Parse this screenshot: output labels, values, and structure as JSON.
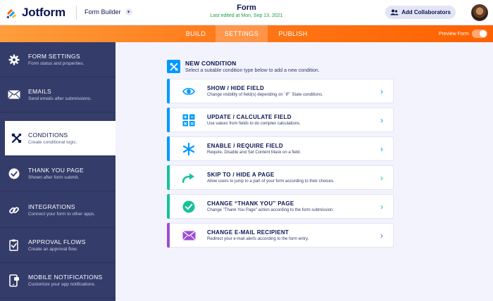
{
  "header": {
    "logo_text": "Jotform",
    "builder_label": "Form Builder",
    "form_title": "Form",
    "last_edited": "Last edited at Mon, Sep 13, 2021",
    "collaborators_label": "Add Collaborators"
  },
  "nav": {
    "tabs": [
      {
        "label": "BUILD"
      },
      {
        "label": "SETTINGS"
      },
      {
        "label": "PUBLISH"
      }
    ],
    "preview_label": "Preview Form",
    "active_tab": "SETTINGS"
  },
  "sidebar": {
    "items": [
      {
        "title": "FORM SETTINGS",
        "desc": "Form status and properties.",
        "icon": "gear-icon"
      },
      {
        "title": "EMAILS",
        "desc": "Send emails after submissions.",
        "icon": "envelope-icon"
      },
      {
        "title": "CONDITIONS",
        "desc": "Create conditional logic.",
        "icon": "conditions-icon"
      },
      {
        "title": "THANK YOU PAGE",
        "desc": "Shown after form submit.",
        "icon": "check-circle-icon"
      },
      {
        "title": "INTEGRATIONS",
        "desc": "Connect your form to other apps.",
        "icon": "link-icon"
      },
      {
        "title": "APPROVAL FLOWS",
        "desc": "Create an approval flow.",
        "icon": "approval-icon"
      },
      {
        "title": "MOBILE NOTIFICATIONS",
        "desc": "Customize your app notifications.",
        "icon": "mobile-icon"
      }
    ],
    "active_item": "CONDITIONS"
  },
  "main": {
    "title": "NEW CONDITION",
    "subtitle": "Select a suitable condition type below to add a new condition.",
    "conditions": [
      {
        "title": "SHOW / HIDE FIELD",
        "desc": "Change visibility of field(s) depending on `IF` State conditions.",
        "color": "#0099ff",
        "icon": "eye-icon"
      },
      {
        "title": "UPDATE / CALCULATE FIELD",
        "desc": "Use values from fields to do complex calculations.",
        "color": "#0099ff",
        "icon": "calculator-icon"
      },
      {
        "title": "ENABLE / REQUIRE FIELD",
        "desc": "Require, Disable and Set Content Mask on a field.",
        "color": "#0099ff",
        "icon": "asterisk-icon"
      },
      {
        "title": "SKIP TO / HIDE A PAGE",
        "desc": "Allow users to jump to a part of your form according to their choices.",
        "color": "#18c19a",
        "icon": "skip-arrow-icon"
      },
      {
        "title": "CHANGE “THANK YOU” PAGE",
        "desc": "Change \"Thank You Page\" action according to the form submission.",
        "color": "#18c19a",
        "icon": "check-circle-icon"
      },
      {
        "title": "CHANGE E-MAIL RECIPIENT",
        "desc": "Redirect your e-mail alerts according to the form entry.",
        "color": "#9c4dd3",
        "icon": "envelope-icon"
      }
    ]
  },
  "colors": {
    "brand_orange": "#ff6100",
    "sidebar_bg": "#343c6a",
    "blue": "#0099ff",
    "green": "#18c19a",
    "purple": "#9c4dd3"
  }
}
